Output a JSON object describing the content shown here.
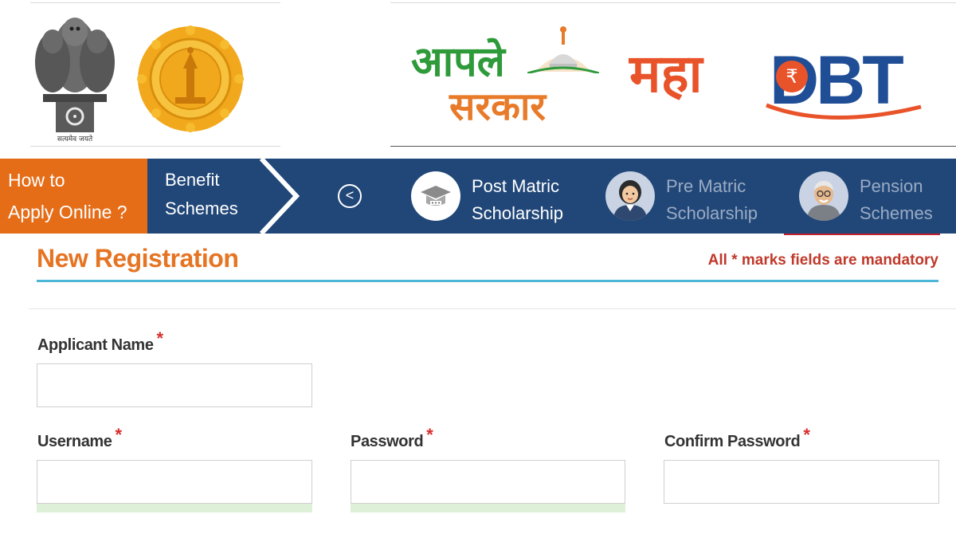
{
  "header": {
    "emblem_motto": "सत्यमेव जयते",
    "brand_left_line1": "आपले",
    "brand_left_line2": "सरकार",
    "brand_right_devanagari": "महा",
    "brand_right_latin": "DBT",
    "brand_right_symbol": "₹",
    "colors": {
      "green": "#2e9a3a",
      "orange": "#e87b2a",
      "dbt_blue": "#1f4e96",
      "dbt_orange": "#e9532a"
    }
  },
  "nav": {
    "how_to": [
      "How to",
      "Apply Online ?"
    ],
    "benefit": [
      "Benefit",
      "Schemes"
    ],
    "prev_symbol": "<",
    "slides": [
      {
        "line1": "Post Matric",
        "line2": "Scholarship",
        "icon": "graduation-cap-icon",
        "active": true
      },
      {
        "line1": "Pre Matric",
        "line2": "Scholarship",
        "icon": "student-girl-icon",
        "active": false
      },
      {
        "line1": "Pension",
        "line2": "Schemes",
        "icon": "elderly-man-icon",
        "active": false
      }
    ],
    "colors": {
      "bar": "#214778",
      "how_to_bg": "#e56d18"
    }
  },
  "form": {
    "title": "New Registration",
    "mandatory_note": "All * marks fields are mandatory",
    "required_mark": "*",
    "fields": {
      "applicant_name": {
        "label": "Applicant Name",
        "value": ""
      },
      "username": {
        "label": "Username",
        "value": ""
      },
      "password": {
        "label": "Password",
        "value": ""
      },
      "confirm_password": {
        "label": "Confirm Password",
        "value": ""
      }
    }
  }
}
